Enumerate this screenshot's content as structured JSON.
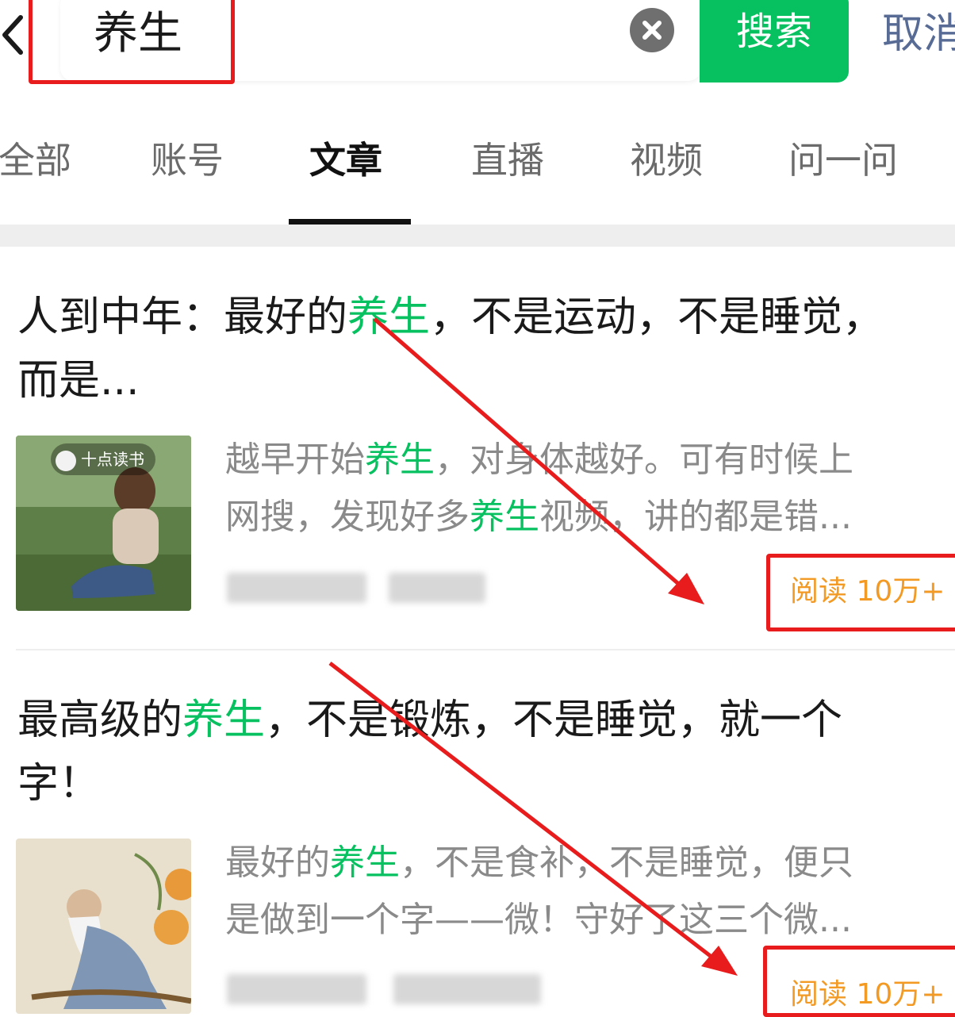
{
  "search": {
    "value": "养生",
    "button_label": "搜索",
    "cancel_label": "取消"
  },
  "tabs": [
    {
      "label": "全部",
      "active": false
    },
    {
      "label": "账号",
      "active": false
    },
    {
      "label": "文章",
      "active": true
    },
    {
      "label": "直播",
      "active": false
    },
    {
      "label": "视频",
      "active": false
    },
    {
      "label": "问一问",
      "active": false
    }
  ],
  "articles": [
    {
      "title_parts": [
        "人到中年：最好的",
        "养生",
        "，不是运动，不是睡觉，",
        "而是..."
      ],
      "thumbnail_badge": "十点读书",
      "snippet_line1": [
        "越早开始",
        "养生",
        "，对身体越好。可有时候上"
      ],
      "snippet_line2": [
        "网搜，发现好多",
        "养生",
        "视频，讲的都是错..."
      ],
      "reads": "阅读 10万+"
    },
    {
      "title_parts": [
        "最高级的",
        "养生",
        "，不是锻炼，不是睡觉，就一个",
        "字！"
      ],
      "snippet_line1": [
        "最好的",
        "养生",
        "，不是食补，不是睡觉，便只"
      ],
      "snippet_line2": [
        "是做到一个字——微！守好了这三个微..."
      ],
      "reads": "阅读 10万+"
    }
  ],
  "colors": {
    "accent_green": "#07c160",
    "annotation_red": "#e81c1c",
    "reads_orange": "#f29a24",
    "cancel_blue": "#576b95"
  },
  "icons": [
    "back-chevron-icon",
    "clear-icon"
  ]
}
